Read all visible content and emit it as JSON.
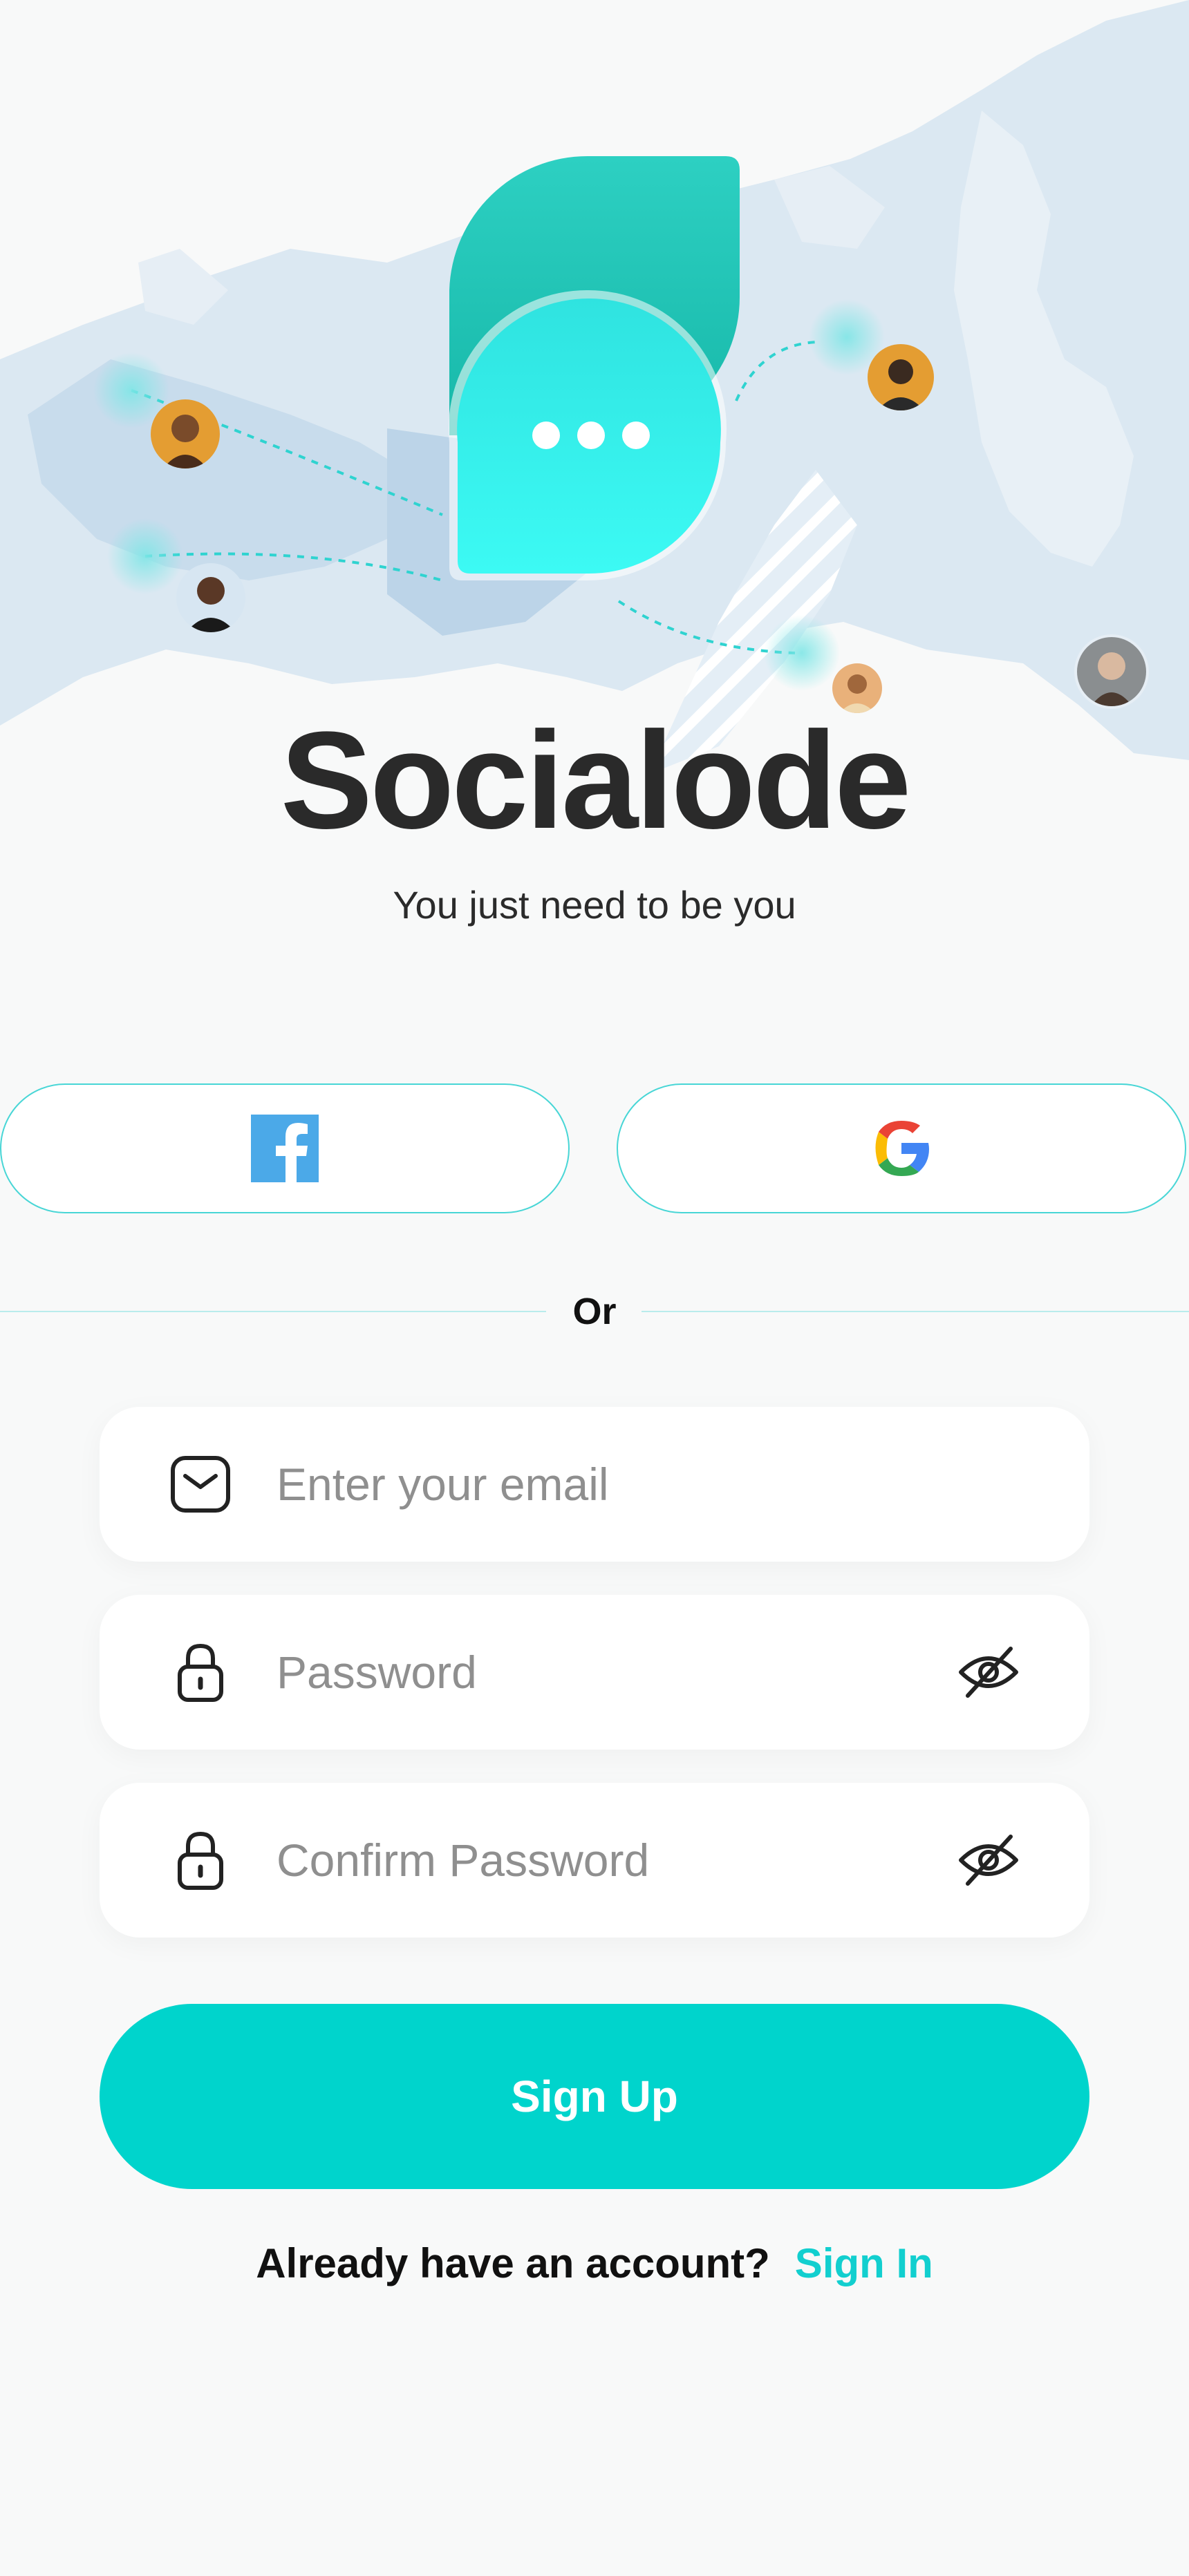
{
  "app": {
    "name": "Socialode",
    "tagline": "You just need to be you"
  },
  "social": {
    "facebook_icon": "facebook-icon",
    "google_icon": "google-icon"
  },
  "divider": {
    "text": "Or"
  },
  "form": {
    "email": {
      "placeholder": "Enter your email",
      "icon": "mail-icon"
    },
    "password": {
      "placeholder": "Password",
      "icon": "lock-icon",
      "toggle_icon": "eye-off-icon"
    },
    "confirm_password": {
      "placeholder": "Confirm Password",
      "icon": "lock-icon",
      "toggle_icon": "eye-off-icon"
    },
    "submit_label": "Sign Up"
  },
  "footer": {
    "question": "Already have an account?",
    "link_label": "Sign In"
  },
  "colors": {
    "accent": "#00D4CC",
    "logo_back": "#20C7B9",
    "logo_front": "#3AF3EE",
    "text_dark": "#2A2A2A",
    "placeholder": "#8F8F8F",
    "facebook_blue": "#4BA9E8"
  }
}
